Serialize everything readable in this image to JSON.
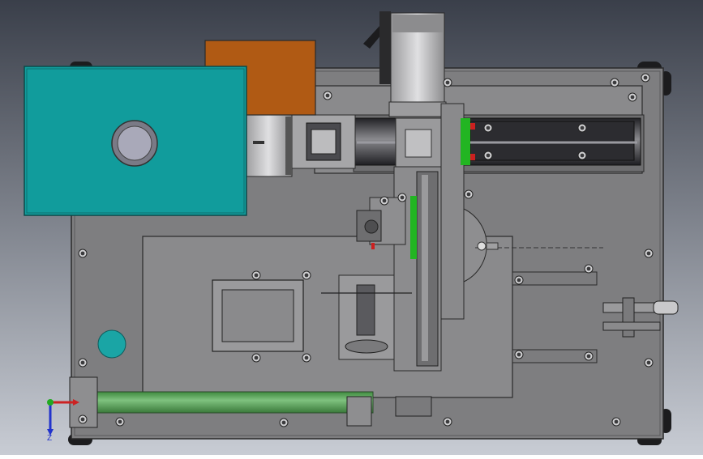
{
  "viewport": {
    "background_top": "#3a3f4a",
    "background_bottom": "#c8ccd4",
    "view_orientation": "top"
  },
  "colors": {
    "plate": "#7e7e80",
    "plate_dark": "#6c6c6e",
    "inner_plate": "#8a8a8c",
    "teal_cover": "#119c9c",
    "teal_knob": "#1aa5a5",
    "orange_block": "#b05a14",
    "green_rod": "#5fa85f",
    "green_rail": "#22b522",
    "red_marker": "#cc2020",
    "rail_dark": "#2f2f33",
    "motor_silver": "#c7c7c9",
    "edge": "#2a2a2a"
  },
  "triad": {
    "x_label": "",
    "y_label": "",
    "z_label": "Z",
    "x_color": "#cc2222",
    "y_color": "#22aa22",
    "z_color": "#2233cc"
  },
  "icons": [
    "triad-icon",
    "bolt-hole-icon"
  ]
}
